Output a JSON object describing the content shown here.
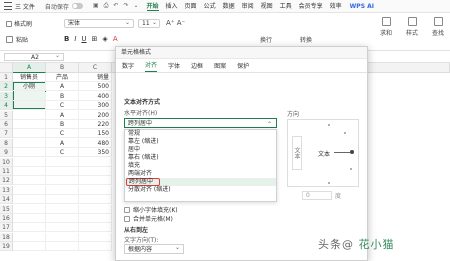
{
  "app": {
    "menu_label": "三 文件",
    "autosave_label": "自动保存",
    "menus": [
      {
        "label": "开始",
        "active": true
      },
      {
        "label": "插入",
        "active": false
      },
      {
        "label": "页面",
        "active": false
      },
      {
        "label": "公式",
        "active": false
      },
      {
        "label": "数据",
        "active": false
      },
      {
        "label": "审阅",
        "active": false
      },
      {
        "label": "视图",
        "active": false
      },
      {
        "label": "工具",
        "active": false
      },
      {
        "label": "会员专享",
        "active": false
      },
      {
        "label": "效率",
        "active": false
      }
    ],
    "ai_label": "WPS AI",
    "accent_color": "#1e7f4e"
  },
  "ribbon": {
    "format_painter": "格式刷",
    "paste": "粘贴",
    "font_name": "宋体",
    "font_size": "11",
    "wrap_label": "换行",
    "convert_label": "转换",
    "right_groups": [
      "求和",
      "样式",
      "查找"
    ]
  },
  "formula_bar": {
    "cell_ref": "A2"
  },
  "sheet": {
    "columns": [
      "A",
      "B",
      "C"
    ],
    "rows": [
      "1",
      "2",
      "3",
      "4",
      "5",
      "6",
      "7",
      "8",
      "9",
      "10",
      "11",
      "12",
      "13",
      "14",
      "15",
      "16",
      "17",
      "18",
      "19"
    ],
    "cells": [
      [
        "销售员",
        "产品",
        "销量"
      ],
      [
        "小刚",
        "A",
        "500"
      ],
      [
        "",
        "B",
        "400"
      ],
      [
        "",
        "C",
        "300"
      ],
      [
        "",
        "A",
        "200"
      ],
      [
        "",
        "B",
        "220"
      ],
      [
        "",
        "C",
        "150"
      ],
      [
        "",
        "A",
        "480"
      ],
      [
        "",
        "C",
        "350"
      ]
    ]
  },
  "dialog": {
    "title": "单元格格式",
    "tabs": [
      {
        "label": "数字",
        "active": false
      },
      {
        "label": "对齐",
        "active": true
      },
      {
        "label": "字体",
        "active": false
      },
      {
        "label": "边框",
        "active": false
      },
      {
        "label": "图案",
        "active": false
      },
      {
        "label": "保护",
        "active": false
      }
    ],
    "text_align_title": "文本对齐方式",
    "h_align_label": "水平对齐(H)",
    "h_align_value": "跨列居中",
    "h_align_options": [
      {
        "label": "常规",
        "highlight": false,
        "hover": false
      },
      {
        "label": "靠左 (缩进)",
        "highlight": false,
        "hover": false
      },
      {
        "label": "居中",
        "highlight": false,
        "hover": false
      },
      {
        "label": "靠右 (缩进)",
        "highlight": false,
        "hover": false
      },
      {
        "label": "填充",
        "highlight": false,
        "hover": false
      },
      {
        "label": "两端对齐",
        "highlight": false,
        "hover": false
      },
      {
        "label": "跨列居中",
        "highlight": true,
        "hover": true
      },
      {
        "label": "分散对齐 (缩进)",
        "highlight": false,
        "hover": false
      }
    ],
    "checkboxes": [
      {
        "label": "缩小字体填充(K)"
      },
      {
        "label": "合并单元格(M)"
      }
    ],
    "orientation_label": "方向",
    "orientation_vertical": "文本",
    "orientation_text": "文本",
    "degree_value": "0",
    "degree_unit": "度",
    "rtl_title": "从右到左",
    "direction_label": "文字方向(T):",
    "direction_value": "根据内容"
  },
  "watermark": {
    "text_left": "头条@",
    "text_right": "花小猫"
  }
}
